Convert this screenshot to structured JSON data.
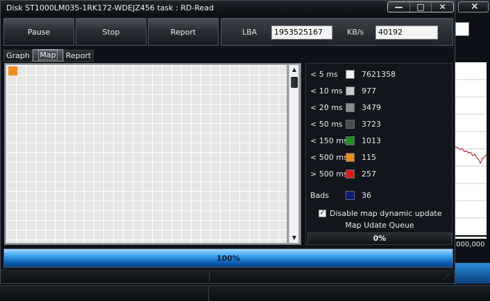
{
  "window": {
    "title": "Disk ST1000LM035-1RK172-WDEJZ456   task : RD-Read",
    "controls": {
      "minimize": "—",
      "maximize": "□",
      "close": "✕"
    }
  },
  "toolbar": {
    "pause_label": "Pause",
    "stop_label": "Stop",
    "report_label": "Report",
    "lba_label": "LBA",
    "lba_value": "1953525167",
    "kbs_label": "KB/s",
    "kbs_value": "40192"
  },
  "tabs": [
    {
      "label": "Graph"
    },
    {
      "label": "Map",
      "active": true
    },
    {
      "label": "Report"
    }
  ],
  "map": {
    "cell_color": "#e6e6e6",
    "highlight_color": "#f28c1a",
    "scroll_up_icon": "▲",
    "scroll_down_icon": "▼"
  },
  "legend": {
    "rows": [
      {
        "label": "< 5 ms",
        "color": "#f2f2f2",
        "value": "7621358"
      },
      {
        "label": "< 10 ms",
        "color": "#c8c8c8",
        "value": "977"
      },
      {
        "label": "< 20 ms",
        "color": "#8c8c8c",
        "value": "3479"
      },
      {
        "label": "< 50 ms",
        "color": "#4a4a4a",
        "value": "3723"
      },
      {
        "label": "< 150 ms",
        "color": "#1f8f1f",
        "value": "1013"
      },
      {
        "label": "< 500 ms",
        "color": "#f28c1a",
        "value": "115"
      },
      {
        "label": "> 500 ms",
        "color": "#e01818",
        "value": "257"
      }
    ],
    "bads": {
      "label": "Bads",
      "color": "#0a1a7a",
      "value": "36"
    },
    "checkbox_label": "Disable map dynamic update",
    "checkbox_checked": true,
    "queue_label": "Map Udate Queue",
    "queue_value": "0%"
  },
  "progress": {
    "percent_text": "100%",
    "fraction": 1.0
  },
  "background_window": {
    "close_glyph": "✕",
    "axis_label": ",000,000"
  }
}
